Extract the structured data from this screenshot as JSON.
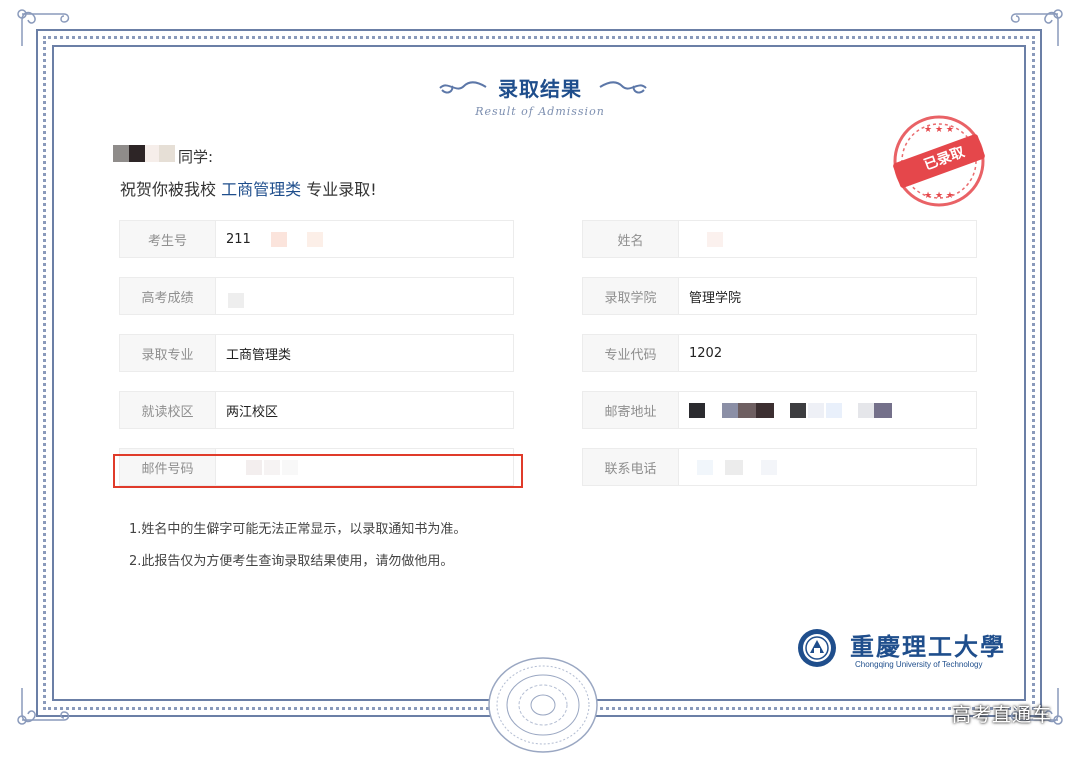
{
  "header": {
    "title": "录取结果",
    "subtitle": "Result of Admission"
  },
  "stamp": {
    "text": "已录取",
    "color": "#e5474b"
  },
  "greeting": {
    "suffix": "同学:",
    "prefix": "祝贺你被我校",
    "major": "工商管理类",
    "suffix2": "专业录取!"
  },
  "fields": {
    "exam_no": {
      "label": "考生号",
      "value": "211"
    },
    "name": {
      "label": "姓名",
      "value": ""
    },
    "score": {
      "label": "高考成绩",
      "value": ""
    },
    "college": {
      "label": "录取学院",
      "value": "管理学院"
    },
    "major": {
      "label": "录取专业",
      "value": "工商管理类"
    },
    "major_code": {
      "label": "专业代码",
      "value": "1202"
    },
    "campus": {
      "label": "就读校区",
      "value": "两江校区"
    },
    "address": {
      "label": "邮寄地址",
      "value": ""
    },
    "postcode": {
      "label": "邮件号码",
      "value": ""
    },
    "phone": {
      "label": "联系电话",
      "value": ""
    }
  },
  "notes": [
    "1.姓名中的生僻字可能无法正常显示，以录取通知书为准。",
    "2.此报告仅为方便考生查询录取结果使用，请勿做他用。"
  ],
  "logo": {
    "name_cn": "重慶理工大學",
    "name_en": "Chongqing University of Technology"
  },
  "watermark": "高考直通车",
  "colors": {
    "brand_blue": "#1f4e8c",
    "highlight_red": "#e03b2a",
    "border": "#6b7fa6"
  }
}
